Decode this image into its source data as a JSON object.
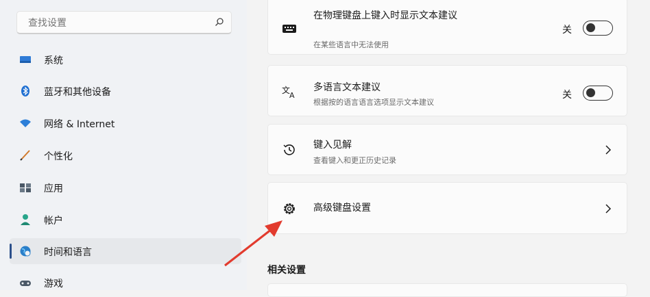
{
  "sidebar": {
    "search_placeholder": "查找设置",
    "items": [
      {
        "label": "系统",
        "icon": "monitor-icon"
      },
      {
        "label": "蓝牙和其他设备",
        "icon": "bluetooth-icon"
      },
      {
        "label": "网络 & Internet",
        "icon": "wifi-icon"
      },
      {
        "label": "个性化",
        "icon": "brush-icon"
      },
      {
        "label": "应用",
        "icon": "apps-icon"
      },
      {
        "label": "帐户",
        "icon": "person-icon"
      },
      {
        "label": "时间和语言",
        "icon": "globe-clock-icon",
        "active": true
      },
      {
        "label": "游戏",
        "icon": "gamepad-icon"
      }
    ]
  },
  "main": {
    "cards": [
      {
        "title": "在物理键盘上键入时显示文本建议",
        "subtitle": "在某些语言中无法使用",
        "toggle_label": "关",
        "icon": "keyboard-icon"
      },
      {
        "title": "多语言文本建议",
        "subtitle": "根据按的语言语言选项显示文本建议",
        "toggle_label": "关",
        "icon": "language-icon"
      },
      {
        "title": "键入见解",
        "subtitle": "查看键入和更正历史记录",
        "icon": "history-icon"
      },
      {
        "title": "高级键盘设置",
        "icon": "gear-icon"
      }
    ],
    "related_title": "相关设置"
  },
  "colors": {
    "accent": "#2b4f8a",
    "arrow": "#e23b2e"
  }
}
